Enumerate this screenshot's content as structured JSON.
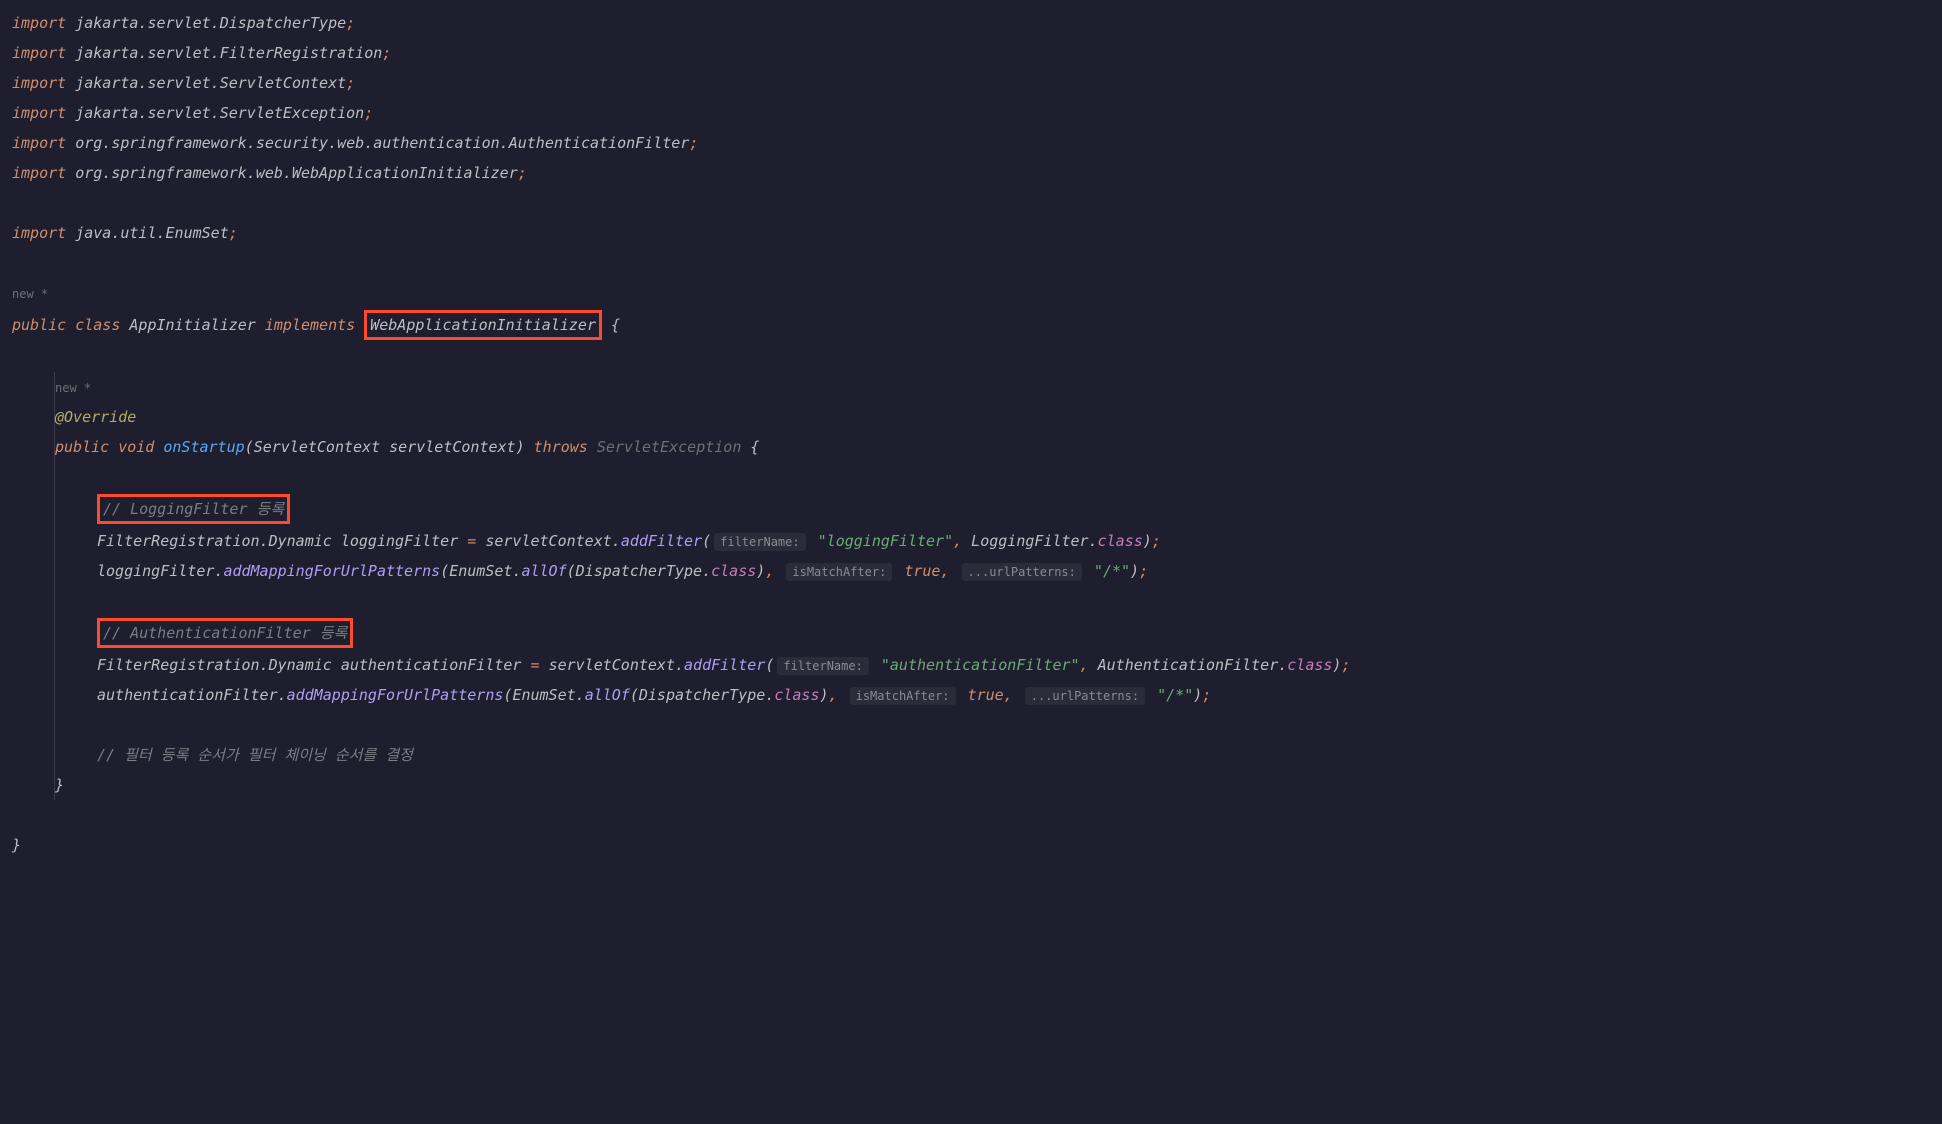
{
  "imports": [
    "jakarta.servlet.DispatcherType",
    "jakarta.servlet.FilterRegistration",
    "jakarta.servlet.ServletContext",
    "jakarta.servlet.ServletException",
    "org.springframework.security.web.authentication.AuthenticationFilter",
    "org.springframework.web.WebApplicationInitializer"
  ],
  "import7": "java.util.EnumSet",
  "hints": {
    "new1": "new *",
    "new2": "new *",
    "filterName": "filterName:",
    "isMatchAfter": "isMatchAfter:",
    "urlPatterns": "...urlPatterns:"
  },
  "keywords": {
    "import": "import",
    "public": "public",
    "class": "class",
    "implements": "implements",
    "void": "void",
    "throws": "throws"
  },
  "classDecl": {
    "name": "AppInitializer",
    "implements": "WebApplicationInitializer"
  },
  "annotation": "@Override",
  "method": {
    "name": "onStartup",
    "paramType": "ServletContext",
    "paramName": "servletContext",
    "throws": "ServletException"
  },
  "comments": {
    "logging": "// LoggingFilter 등록",
    "auth": "// AuthenticationFilter 등록",
    "order": "// 필터 등록 순서가 필터 체이닝 순서를 결정"
  },
  "code": {
    "filterRegistration": "FilterRegistration",
    "dynamic": "Dynamic",
    "loggingFilter": "loggingFilter",
    "authenticationFilter": "authenticationFilter",
    "servletContext": "servletContext",
    "addFilter": "addFilter",
    "addMapping": "addMappingForUrlPatterns",
    "enumSet": "EnumSet",
    "allOf": "allOf",
    "dispatcherType": "DispatcherType",
    "classField": "class",
    "loggingFilterType": "LoggingFilter",
    "authFilterType": "AuthenticationFilter",
    "true": "true"
  },
  "strings": {
    "loggingFilter": "\"loggingFilter\"",
    "authFilter": "\"authenticationFilter\"",
    "pattern": "\"/*\""
  }
}
